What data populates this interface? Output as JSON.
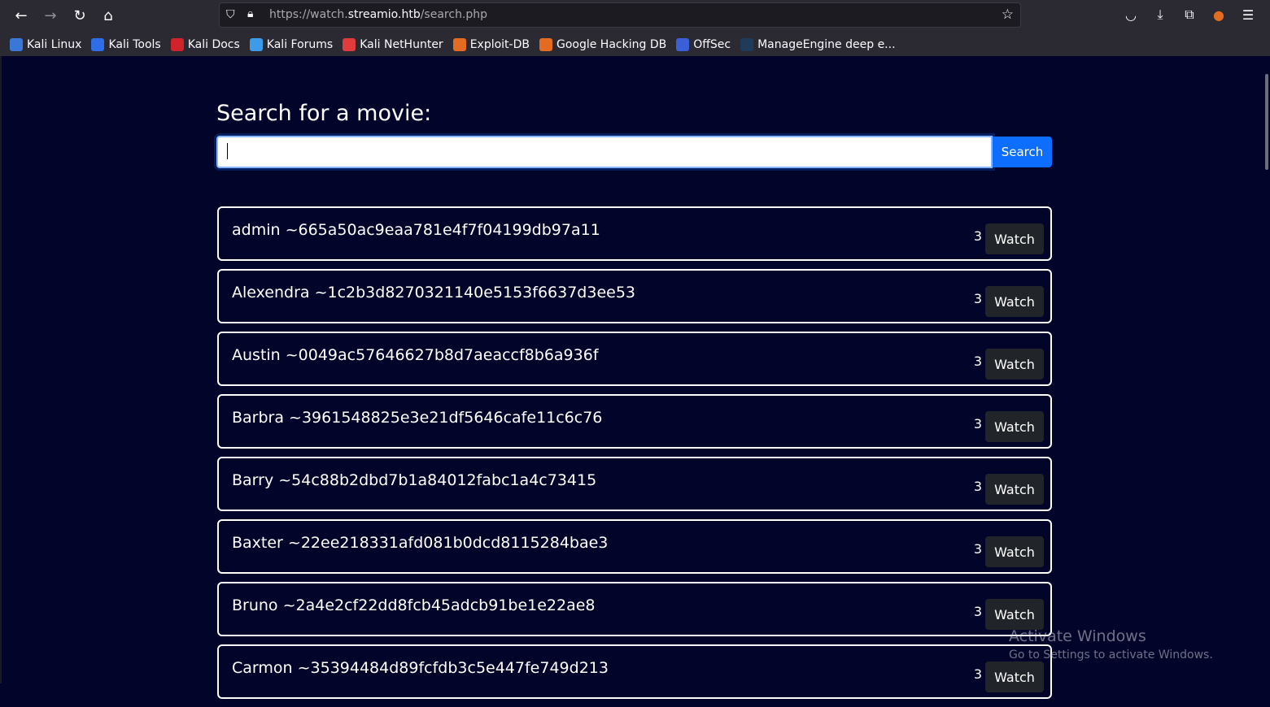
{
  "browser": {
    "url_prefix": "https://watch.",
    "url_domain": "streamio.htb",
    "url_path": "/search.php",
    "bookmarks": [
      {
        "label": "Kali Linux",
        "color": "#3a78d8"
      },
      {
        "label": "Kali Tools",
        "color": "#2f6ee8"
      },
      {
        "label": "Kali Docs",
        "color": "#d2232a"
      },
      {
        "label": "Kali Forums",
        "color": "#3d9be9"
      },
      {
        "label": "Kali NetHunter",
        "color": "#e23b3b"
      },
      {
        "label": "Exploit-DB",
        "color": "#e36b22"
      },
      {
        "label": "Google Hacking DB",
        "color": "#e36b22"
      },
      {
        "label": "OffSec",
        "color": "#3a5fd8"
      },
      {
        "label": "ManageEngine deep e...",
        "color": "#1f3b5a"
      }
    ]
  },
  "page": {
    "heading": "Search for a movie:",
    "search_placeholder": "",
    "search_button": "Search",
    "results": [
      {
        "title": "admin ~665a50ac9eaa781e4f7f04199db97a11",
        "count": "3",
        "button": "Watch"
      },
      {
        "title": "Alexendra ~1c2b3d8270321140e5153f6637d3ee53",
        "count": "3",
        "button": "Watch"
      },
      {
        "title": "Austin ~0049ac57646627b8d7aeaccf8b6a936f",
        "count": "3",
        "button": "Watch"
      },
      {
        "title": "Barbra ~3961548825e3e21df5646cafe11c6c76",
        "count": "3",
        "button": "Watch"
      },
      {
        "title": "Barry ~54c88b2dbd7b1a84012fabc1a4c73415",
        "count": "3",
        "button": "Watch"
      },
      {
        "title": "Baxter ~22ee218331afd081b0dcd8115284bae3",
        "count": "3",
        "button": "Watch"
      },
      {
        "title": "Bruno ~2a4e2cf22dd8fcb45adcb91be1e22ae8",
        "count": "3",
        "button": "Watch"
      },
      {
        "title": "Carmon ~35394484d89fcfdb3c5e447fe749d213",
        "count": "3",
        "button": "Watch"
      }
    ]
  },
  "overlay": {
    "line1": "Activate Windows",
    "line2": "Go to Settings to activate Windows."
  }
}
